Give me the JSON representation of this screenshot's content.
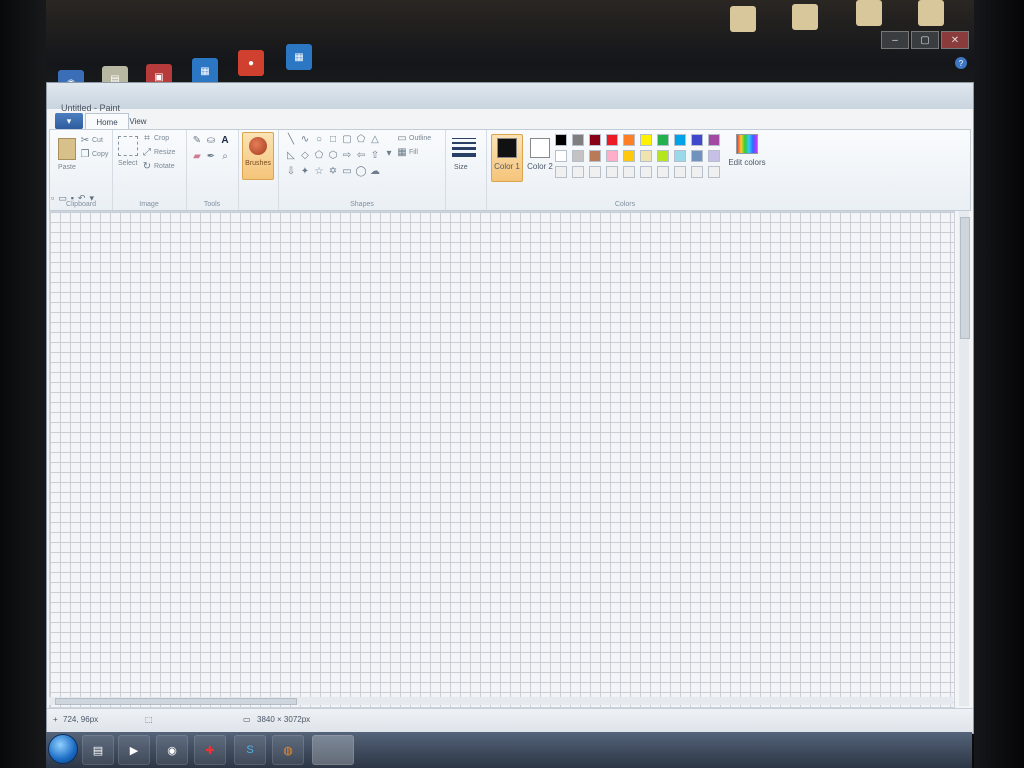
{
  "window": {
    "title": "Untitled - Paint"
  },
  "ribbon": {
    "file_tab": "▾",
    "tabs": [
      "Home",
      "View"
    ],
    "clipboard": {
      "paste": "Paste",
      "cut": "Cut",
      "copy": "Copy",
      "label": "Clipboard"
    },
    "image": {
      "select": "Select",
      "crop": "Crop",
      "resize": "Resize",
      "rotate": "Rotate",
      "label": "Image"
    },
    "tools": {
      "label": "Tools",
      "text_glyph": "A"
    },
    "brushes": {
      "label": "Brushes"
    },
    "shapes": {
      "outline": "Outline",
      "fill": "Fill",
      "label": "Shapes"
    },
    "size": {
      "label": "Size"
    },
    "colors": {
      "color1": "Color 1",
      "color2": "Color 2",
      "edit": "Edit colors",
      "label": "Colors",
      "color1_value": "#111111",
      "color2_value": "#ffffff",
      "palette_row1": [
        "#000000",
        "#7f7f7f",
        "#880015",
        "#ed1c24",
        "#ff7f27",
        "#fff200",
        "#22b14c",
        "#00a2e8",
        "#3f48cc",
        "#a349a4"
      ],
      "palette_row2": [
        "#ffffff",
        "#c3c3c3",
        "#b97a57",
        "#ffaec9",
        "#ffc90e",
        "#efe4b0",
        "#b5e61d",
        "#99d9ea",
        "#7092be",
        "#c8bfe7"
      ],
      "palette_row3": [
        "#f0f0f0",
        "#f0f0f0",
        "#f0f0f0",
        "#f0f0f0",
        "#f0f0f0",
        "#f0f0f0",
        "#f0f0f0",
        "#f0f0f0",
        "#f0f0f0",
        "#f0f0f0"
      ]
    }
  },
  "status": {
    "cursor_position": "724, 96px",
    "canvas_size": "3840 × 3072px"
  },
  "icons": {
    "desktop": [
      "folder-icon",
      "folder-icon",
      "folder-icon",
      "folder-icon"
    ],
    "taskbar": [
      "explorer-icon",
      "media-player-icon",
      "chrome-icon",
      "acrobat-icon",
      "skype-icon",
      "firefox-icon",
      "paint-icon"
    ]
  }
}
